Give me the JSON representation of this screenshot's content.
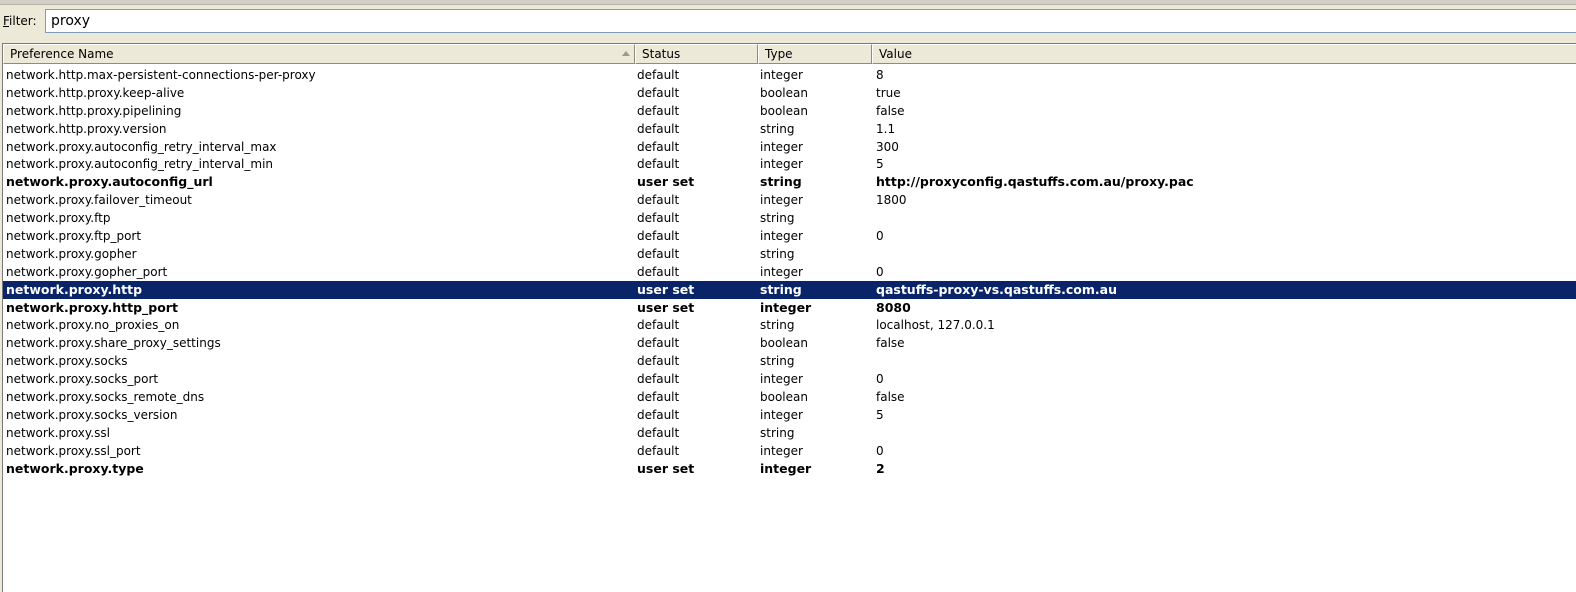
{
  "filter": {
    "label_accel": "F",
    "label_rest": "ilter:",
    "value": "proxy"
  },
  "columns": [
    "Preference Name",
    "Status",
    "Type",
    "Value"
  ],
  "rows": [
    {
      "name": "network.http.max-persistent-connections-per-proxy",
      "status": "default",
      "type": "integer",
      "value": "8"
    },
    {
      "name": "network.http.proxy.keep-alive",
      "status": "default",
      "type": "boolean",
      "value": "true"
    },
    {
      "name": "network.http.proxy.pipelining",
      "status": "default",
      "type": "boolean",
      "value": "false"
    },
    {
      "name": "network.http.proxy.version",
      "status": "default",
      "type": "string",
      "value": "1.1"
    },
    {
      "name": "network.proxy.autoconfig_retry_interval_max",
      "status": "default",
      "type": "integer",
      "value": "300"
    },
    {
      "name": "network.proxy.autoconfig_retry_interval_min",
      "status": "default",
      "type": "integer",
      "value": "5"
    },
    {
      "name": "network.proxy.autoconfig_url",
      "status": "user set",
      "type": "string",
      "value": "http://proxyconfig.qastuffs.com.au/proxy.pac"
    },
    {
      "name": "network.proxy.failover_timeout",
      "status": "default",
      "type": "integer",
      "value": "1800"
    },
    {
      "name": "network.proxy.ftp",
      "status": "default",
      "type": "string",
      "value": ""
    },
    {
      "name": "network.proxy.ftp_port",
      "status": "default",
      "type": "integer",
      "value": "0"
    },
    {
      "name": "network.proxy.gopher",
      "status": "default",
      "type": "string",
      "value": ""
    },
    {
      "name": "network.proxy.gopher_port",
      "status": "default",
      "type": "integer",
      "value": "0"
    },
    {
      "name": "network.proxy.http",
      "status": "user set",
      "type": "string",
      "value": "qastuffs-proxy-vs.qastuffs.com.au"
    },
    {
      "name": "network.proxy.http_port",
      "status": "user set",
      "type": "integer",
      "value": "8080"
    },
    {
      "name": "network.proxy.no_proxies_on",
      "status": "default",
      "type": "string",
      "value": "localhost, 127.0.0.1"
    },
    {
      "name": "network.proxy.share_proxy_settings",
      "status": "default",
      "type": "boolean",
      "value": "false"
    },
    {
      "name": "network.proxy.socks",
      "status": "default",
      "type": "string",
      "value": ""
    },
    {
      "name": "network.proxy.socks_port",
      "status": "default",
      "type": "integer",
      "value": "0"
    },
    {
      "name": "network.proxy.socks_remote_dns",
      "status": "default",
      "type": "boolean",
      "value": "false"
    },
    {
      "name": "network.proxy.socks_version",
      "status": "default",
      "type": "integer",
      "value": "5"
    },
    {
      "name": "network.proxy.ssl",
      "status": "default",
      "type": "string",
      "value": ""
    },
    {
      "name": "network.proxy.ssl_port",
      "status": "default",
      "type": "integer",
      "value": "0"
    },
    {
      "name": "network.proxy.type",
      "status": "user set",
      "type": "integer",
      "value": "2"
    }
  ],
  "selected_row": "network.proxy.http",
  "colors": {
    "selection_bg": "#0a246a",
    "selection_fg": "#ffffff",
    "chrome_bg": "#ece9d8"
  }
}
